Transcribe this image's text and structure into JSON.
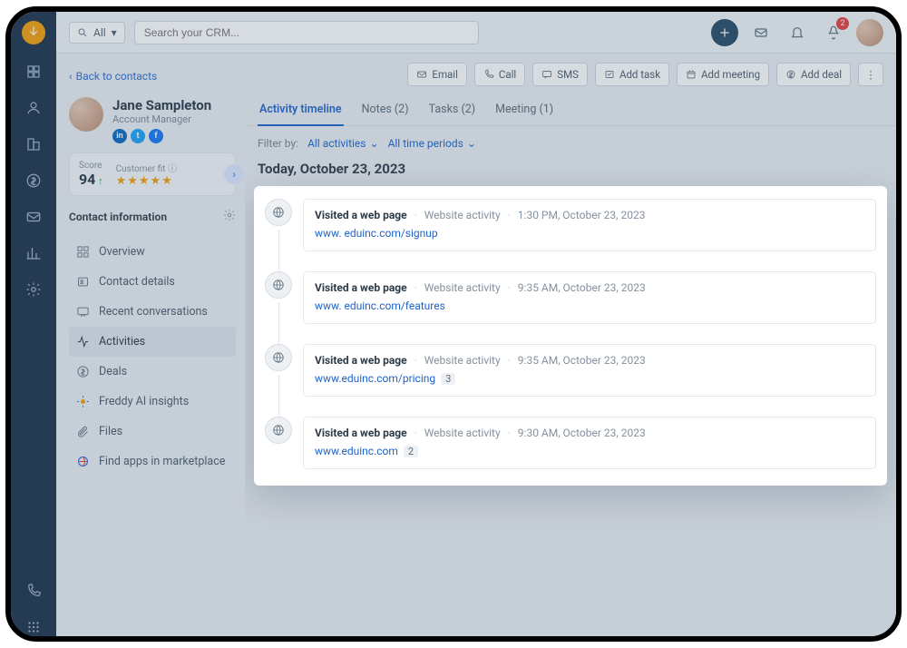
{
  "scope": {
    "label": "All"
  },
  "search": {
    "placeholder": "Search your CRM..."
  },
  "notifications": {
    "count": "2"
  },
  "backlink": "Back to contacts",
  "contact": {
    "name": "Jane Sampleton",
    "role": "Account Manager"
  },
  "score": {
    "label": "Score",
    "value": "94",
    "fit_label": "Customer fit",
    "stars": "★★★★★"
  },
  "section": {
    "contact_info": "Contact information"
  },
  "sidebar": {
    "items": [
      {
        "label": "Overview"
      },
      {
        "label": "Contact details"
      },
      {
        "label": "Recent conversations"
      },
      {
        "label": "Activities"
      },
      {
        "label": "Deals"
      },
      {
        "label": "Freddy AI insights"
      },
      {
        "label": "Files"
      },
      {
        "label": "Find apps in marketplace"
      }
    ]
  },
  "actions": {
    "email": "Email",
    "call": "Call",
    "sms": "SMS",
    "addtask": "Add task",
    "addmeeting": "Add meeting",
    "adddeal": "Add deal"
  },
  "tabs": [
    {
      "label": "Activity timeline"
    },
    {
      "label": "Notes (2)"
    },
    {
      "label": "Tasks (2)"
    },
    {
      "label": "Meeting (1)"
    }
  ],
  "filter": {
    "label": "Filter by:",
    "activities": "All activities",
    "periods": "All time periods"
  },
  "today_heading": "Today, October 23, 2023",
  "timeline": [
    {
      "title": "Visited a web page",
      "type": "Website activity",
      "time": "1:30 PM, October 23, 2023",
      "url": "www. eduinc.com/signup",
      "count": ""
    },
    {
      "title": "Visited a web page",
      "type": "Website activity",
      "time": "9:35 AM, October 23, 2023",
      "url": "www. eduinc.com/features",
      "count": ""
    },
    {
      "title": "Visited a web page",
      "type": "Website activity",
      "time": "9:35 AM, October 23, 2023",
      "url": "www.eduinc.com/pricing",
      "count": "3"
    },
    {
      "title": "Visited a web page",
      "type": "Website activity",
      "time": "9:30 AM, October 23, 2023",
      "url": "www.eduinc.com",
      "count": "2"
    }
  ]
}
